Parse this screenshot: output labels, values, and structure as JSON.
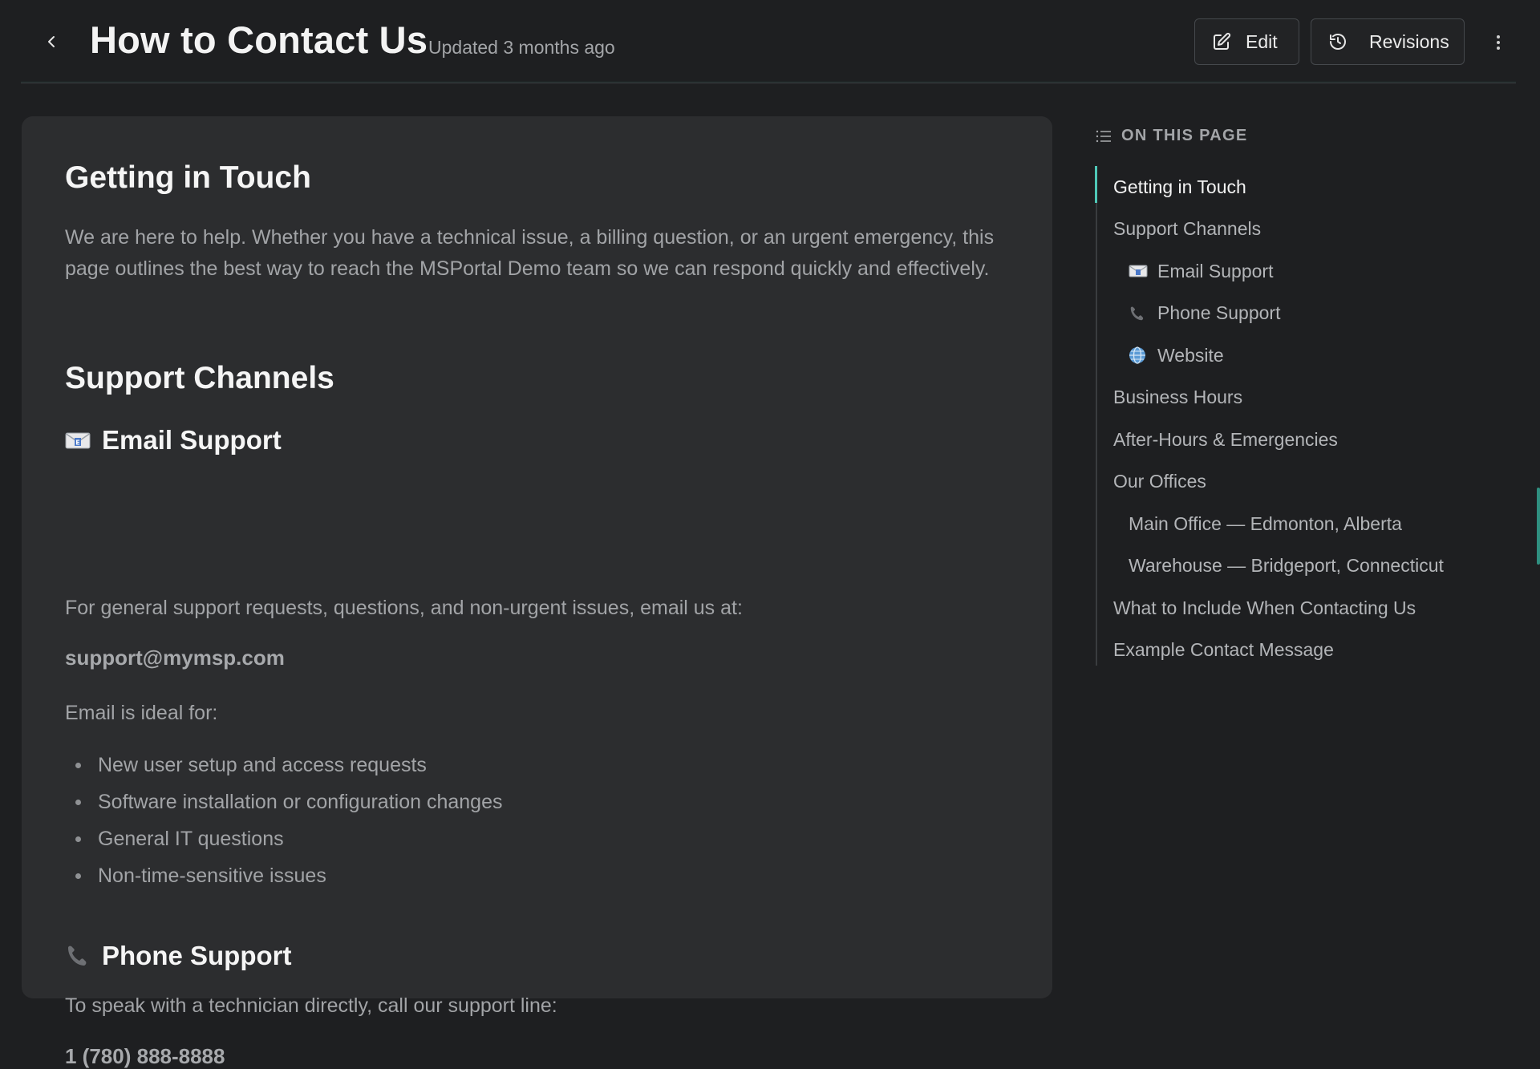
{
  "header": {
    "title": "How to Contact Us",
    "updated": "Updated 3 months ago",
    "edit_label": "Edit",
    "revisions_label": "Revisions"
  },
  "article": {
    "getting_in_touch": {
      "heading": "Getting in Touch",
      "body": "We are here to help. Whether you have a technical issue, a billing question, or an urgent emergency, this page outlines the best way to reach the MSPortal Demo team so we can respond quickly and effectively."
    },
    "support_channels": {
      "heading": "Support Channels"
    },
    "email_support": {
      "heading": "Email Support",
      "intro": "For general support requests, questions, and non-urgent issues, email us at:",
      "address": "support@mymsp.com",
      "ideal_for": "Email is ideal for:",
      "items": [
        "New user setup and access requests",
        "Software installation or configuration changes",
        "General IT questions",
        "Non-time-sensitive issues"
      ]
    },
    "phone_support": {
      "heading": "Phone Support",
      "intro": "To speak with a technician directly, call our support line:",
      "number": "1 (780) 888-8888"
    }
  },
  "toc": {
    "title": "ON THIS PAGE",
    "items": [
      {
        "label": "Getting in Touch",
        "active": true
      },
      {
        "label": "Support Channels"
      },
      {
        "label": "Email Support",
        "icon": "email-icon"
      },
      {
        "label": "Phone Support",
        "icon": "phone-icon"
      },
      {
        "label": "Website",
        "icon": "globe-icon"
      },
      {
        "label": "Business Hours"
      },
      {
        "label": "After-Hours & Emergencies"
      },
      {
        "label": "Our Offices"
      },
      {
        "label": "Main Office — Edmonton, Alberta"
      },
      {
        "label": "Warehouse — Bridgeport, Connecticut"
      },
      {
        "label": "What to Include When Contacting Us"
      },
      {
        "label": "Example Contact Message"
      }
    ]
  },
  "colors": {
    "accent": "#4fc8b8",
    "background": "#1e1f21",
    "card": "#2c2d2f"
  }
}
